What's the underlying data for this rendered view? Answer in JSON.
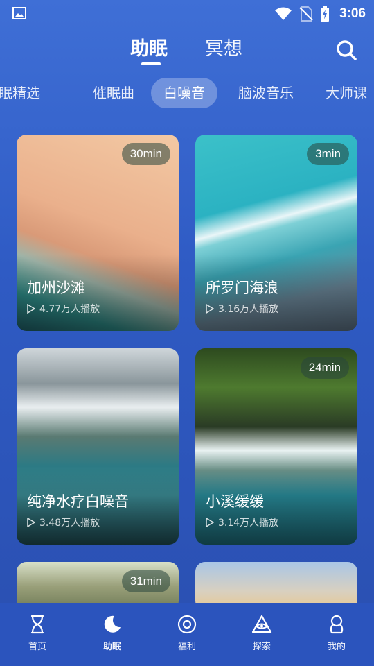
{
  "status_bar": {
    "time": "3:06",
    "icons": [
      "image-icon",
      "wifi-icon",
      "no-sim-icon",
      "battery-charging-icon"
    ]
  },
  "header": {
    "tabs": [
      {
        "label": "助眠",
        "active": true
      },
      {
        "label": "冥想",
        "active": false
      }
    ],
    "search_icon": "search-icon"
  },
  "categories": [
    {
      "label": "助眠精选"
    },
    {
      "label": "催眠曲"
    },
    {
      "label": "白噪音",
      "selected": true
    },
    {
      "label": "脑波音乐"
    },
    {
      "label": "大师课"
    }
  ],
  "cards": [
    {
      "title": "加州沙滩",
      "duration": "30min",
      "plays": "4.77万人播放"
    },
    {
      "title": "所罗门海浪",
      "duration": "3min",
      "plays": "3.16万人播放"
    },
    {
      "title": "纯净水疗白噪音",
      "duration": "",
      "plays": "3.48万人播放"
    },
    {
      "title": "小溪缓缓",
      "duration": "24min",
      "plays": "3.14万人播放"
    },
    {
      "title": "",
      "duration": "31min",
      "plays": ""
    },
    {
      "title": "",
      "duration": "",
      "plays": ""
    }
  ],
  "bottom_nav": [
    {
      "label": "首页",
      "icon": "hourglass-icon",
      "active": false
    },
    {
      "label": "助眠",
      "icon": "moon-icon",
      "active": true
    },
    {
      "label": "福利",
      "icon": "target-icon",
      "active": false
    },
    {
      "label": "探索",
      "icon": "eye-triangle-icon",
      "active": false
    },
    {
      "label": "我的",
      "icon": "profile-icon",
      "active": false
    }
  ],
  "colors": {
    "background_top": "#3f6fd6",
    "background_bottom": "#2a4fb0",
    "nav_bar": "#2b54bd"
  }
}
